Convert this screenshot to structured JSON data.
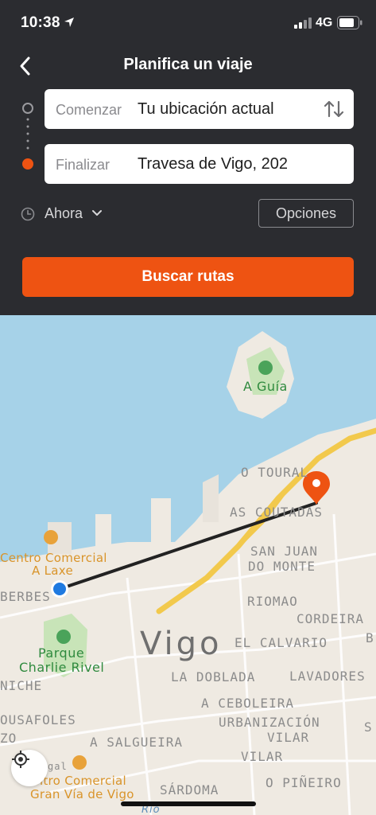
{
  "status_bar": {
    "time": "10:38",
    "network": "4G"
  },
  "header": {
    "title": "Planifica un viaje",
    "back_icon": "chevron-left-icon"
  },
  "route": {
    "start": {
      "label": "Comenzar",
      "value": "Tu ubicación actual"
    },
    "end": {
      "label": "Finalizar",
      "value": "Travesa de Vigo, 202"
    }
  },
  "time_selector": {
    "label": "Ahora"
  },
  "options_label": "Opciones",
  "search_label": "Buscar rutas",
  "colors": {
    "accent": "#ee5312",
    "panel": "#2b2c30",
    "water": "#a6d2e8",
    "land": "#efeae2",
    "road": "#f2c94c",
    "park": "#c8e4b8"
  },
  "map": {
    "labels": {
      "a_guia": "A Guía",
      "o_toural": "O TOURAL",
      "as_coutadas": "AS COUTADAS",
      "san_juan": "SAN JUAN",
      "do_monte": "DO MONTE",
      "centro_a_laxe_1": "Centro Comercial",
      "centro_a_laxe_2": "A Laxe",
      "berbes": "BERBES",
      "riomao": "RIOMAO",
      "cordeira": "CORDEIRA",
      "parque_1": "Parque",
      "parque_2": "Charlie Rivel",
      "vigo": "Vigo",
      "el_calvario": "EL CALVARIO",
      "niche": "NICHE",
      "la_doblada": "LA DOBLADA",
      "lavadores": "LAVADORES",
      "a_ceboleira": "A CEBOLEIRA",
      "ousafoles": "OUSAFOLES",
      "urbanizacion": "URBANIZACIÓN",
      "vilar_1": "VILAR",
      "a_salgueira": "A SALGUEIRA",
      "vilar_2": "VILAR",
      "zo": "ZO",
      "gal": "gal",
      "centro_gran_via_1": "entro Comercial",
      "centro_gran_via_2": "Gran Vía de Vigo",
      "sardoma": "SÁRDOMA",
      "o_pineiro": "O PIÑEIRO",
      "rio": "Río",
      "s_edge": "S",
      "b_edge": "B"
    }
  }
}
